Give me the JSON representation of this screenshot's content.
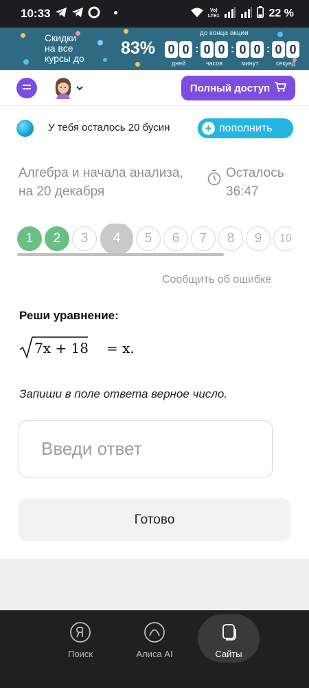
{
  "status_bar": {
    "time": "10:33",
    "lte_top": "Vo)",
    "lte_bottom": "LTE1",
    "battery": "22 %"
  },
  "promo": {
    "text_line1": "Скидки",
    "text_line2": "на все",
    "text_line3": "курсы до",
    "percent": "83%",
    "caption": "до конца акции",
    "timer": [
      {
        "digits": [
          "0",
          "0"
        ],
        "label": "дней"
      },
      {
        "digits": [
          "0",
          "0"
        ],
        "label": "часов"
      },
      {
        "digits": [
          "0",
          "0"
        ],
        "label": "минут"
      },
      {
        "digits": [
          "0",
          "0"
        ],
        "label": "секунд"
      }
    ],
    "colors": {
      "background": "#2e6b83"
    }
  },
  "header": {
    "full_access_label": "Полный доступ",
    "accent_color": "#7c4dde"
  },
  "beads": {
    "text": "У тебя осталось 20 бусин",
    "refill_label": "пополнить"
  },
  "task": {
    "title_line1": "Алгебра и начала анализа,",
    "title_line2": "на 20 декабря",
    "remaining_label": "Осталось",
    "remaining_time": "36:47"
  },
  "pager": {
    "pages": [
      {
        "label": "1",
        "state": "done"
      },
      {
        "label": "2",
        "state": "done"
      },
      {
        "label": "3",
        "state": "todo"
      },
      {
        "label": "4",
        "state": "current"
      },
      {
        "label": "5",
        "state": "todo"
      },
      {
        "label": "6",
        "state": "todo"
      },
      {
        "label": "7",
        "state": "todo"
      },
      {
        "label": "8",
        "state": "todo"
      },
      {
        "label": "9",
        "state": "todo"
      },
      {
        "label": "10",
        "state": "todo"
      }
    ]
  },
  "report_error_label": "Сообщить об ошибке",
  "problem": {
    "heading": "Реши уравнение:",
    "equation_radicand": "7x + 18",
    "equation_rest": "= x.",
    "hint": "Запиши в поле ответа верное число."
  },
  "answer": {
    "placeholder": "Введи ответ",
    "value": ""
  },
  "done_label": "Готово",
  "bottom_nav": {
    "items": [
      {
        "label": "Поиск",
        "icon": "yandex-search-icon"
      },
      {
        "label": "Алиса AI",
        "icon": "alice-icon"
      },
      {
        "label": "Сайты",
        "icon": "sites-icon",
        "active": true
      }
    ]
  }
}
